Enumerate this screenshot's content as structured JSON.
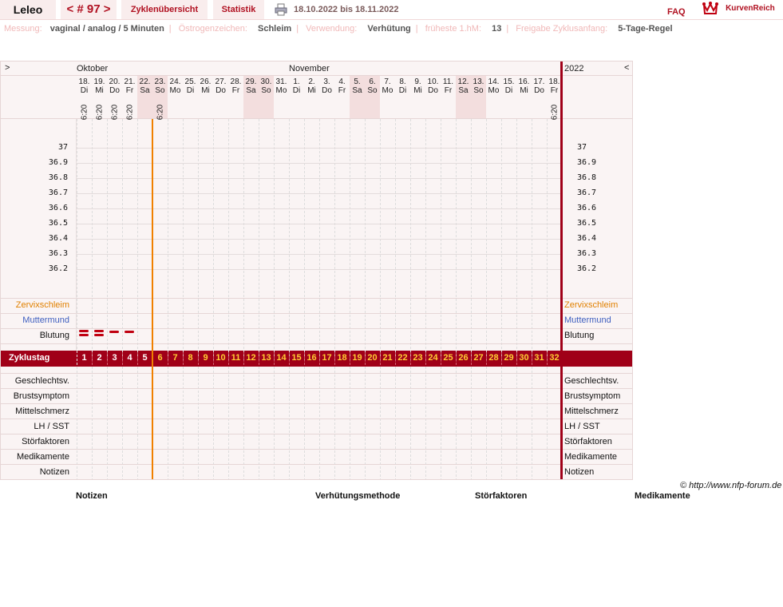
{
  "header": {
    "user": "Leleo",
    "cycle_nav": "< # 97 >",
    "tab_overview": "Zyklenübersicht",
    "tab_stats": "Statistik",
    "date_range": "18.10.2022 bis 18.11.2022",
    "faq": "FAQ",
    "brand": "KurvenReich"
  },
  "info": {
    "messung_label": "Messung:",
    "messung_value": "vaginal / analog / 5 Minuten",
    "oestrogen_label": "Östrogenzeichen:",
    "oestrogen_value": "Schleim",
    "verwendung_label": "Verwendung:",
    "verwendung_value": "Verhütung",
    "fruehest_label": "früheste 1.hM:",
    "fruehest_value": "13",
    "freigabe_label": "Freigabe Zyklusanfang:",
    "freigabe_value": "5-Tage-Regel"
  },
  "chart": {
    "nav_left": ">",
    "nav_right": "<",
    "month_oct": "Oktober",
    "month_nov": "November",
    "year": "2022",
    "days": [
      {
        "d": "18.",
        "w": "Di",
        "t": "6:20"
      },
      {
        "d": "19.",
        "w": "Mi",
        "t": "6:20"
      },
      {
        "d": "20.",
        "w": "Do",
        "t": "6:20"
      },
      {
        "d": "21.",
        "w": "Fr",
        "t": "6:20"
      },
      {
        "d": "22.",
        "w": "Sa",
        "t": ""
      },
      {
        "d": "23.",
        "w": "So",
        "t": "6:20"
      },
      {
        "d": "24.",
        "w": "Mo",
        "t": ""
      },
      {
        "d": "25.",
        "w": "Di",
        "t": ""
      },
      {
        "d": "26.",
        "w": "Mi",
        "t": ""
      },
      {
        "d": "27.",
        "w": "Do",
        "t": ""
      },
      {
        "d": "28.",
        "w": "Fr",
        "t": ""
      },
      {
        "d": "29.",
        "w": "Sa",
        "t": ""
      },
      {
        "d": "30.",
        "w": "So",
        "t": ""
      },
      {
        "d": "31.",
        "w": "Mo",
        "t": ""
      },
      {
        "d": "1.",
        "w": "Di",
        "t": ""
      },
      {
        "d": "2.",
        "w": "Mi",
        "t": ""
      },
      {
        "d": "3.",
        "w": "Do",
        "t": ""
      },
      {
        "d": "4.",
        "w": "Fr",
        "t": ""
      },
      {
        "d": "5.",
        "w": "Sa",
        "t": ""
      },
      {
        "d": "6.",
        "w": "So",
        "t": ""
      },
      {
        "d": "7.",
        "w": "Mo",
        "t": ""
      },
      {
        "d": "8.",
        "w": "Di",
        "t": ""
      },
      {
        "d": "9.",
        "w": "Mi",
        "t": ""
      },
      {
        "d": "10.",
        "w": "Do",
        "t": ""
      },
      {
        "d": "11.",
        "w": "Fr",
        "t": ""
      },
      {
        "d": "12.",
        "w": "Sa",
        "t": ""
      },
      {
        "d": "13.",
        "w": "So",
        "t": ""
      },
      {
        "d": "14.",
        "w": "Mo",
        "t": ""
      },
      {
        "d": "15.",
        "w": "Di",
        "t": ""
      },
      {
        "d": "16.",
        "w": "Mi",
        "t": ""
      },
      {
        "d": "17.",
        "w": "Do",
        "t": ""
      },
      {
        "d": "18.",
        "w": "Fr",
        "t": "6:20"
      }
    ],
    "temps": [
      "37",
      "36.9",
      "36.8",
      "36.7",
      "36.6",
      "36.5",
      "36.4",
      "36.3",
      "36.2"
    ],
    "rows_top": [
      "Zervixschleim",
      "Muttermund",
      "Blutung"
    ],
    "cycle_label": "Zyklustag",
    "cycle_days": [
      "1",
      "2",
      "3",
      "4",
      "5",
      "6",
      "7",
      "8",
      "9",
      "10",
      "11",
      "12",
      "13",
      "14",
      "15",
      "16",
      "17",
      "18",
      "19",
      "20",
      "21",
      "22",
      "23",
      "24",
      "25",
      "26",
      "27",
      "28",
      "29",
      "30",
      "31",
      "32"
    ],
    "rows_bottom": [
      "Geschlechtsv.",
      "Brustsymptom",
      "Mittelschmerz",
      "LH / SST",
      "Störfaktoren",
      "Medikamente",
      "Notizen"
    ],
    "bleeding": [
      2,
      2,
      1,
      1,
      0
    ],
    "colors": {
      "zervix": "#e08000",
      "mutter": "#4060c0",
      "accent": "#a00018",
      "orange_line": "#f08000"
    }
  },
  "footer": {
    "copyright": "© http://www.nfp-forum.de",
    "col1": "Notizen",
    "col2": "Verhütungsmethode",
    "col3": "Störfaktoren",
    "col4": "Medikamente"
  }
}
